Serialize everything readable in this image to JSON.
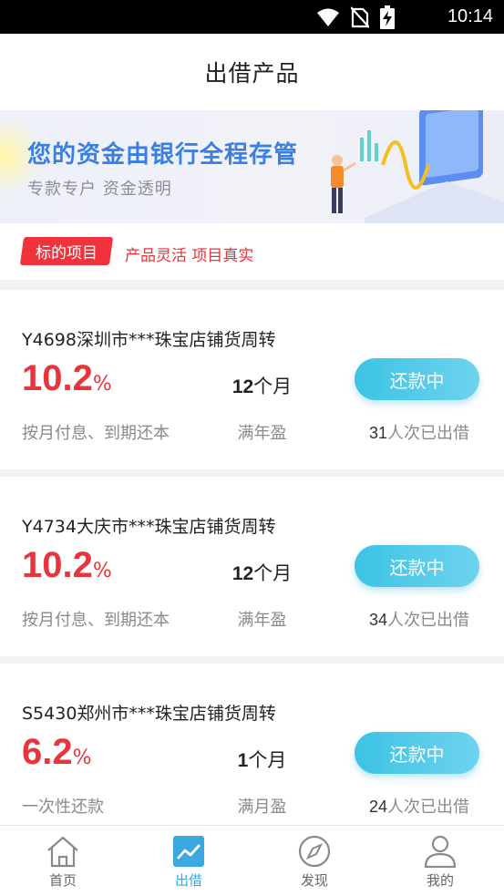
{
  "status_bar": {
    "time": "10:14",
    "icons": [
      "wifi-icon",
      "no-sim-icon",
      "battery-charging-icon"
    ]
  },
  "header": {
    "title": "出借产品"
  },
  "banner": {
    "headline": "您的资金由银行全程存管",
    "subline": "专款专户  资金透明"
  },
  "tag_row": {
    "tag": "标的项目",
    "slogan": "产品灵活 项目真实"
  },
  "products": [
    {
      "name": "Y4698深圳市***珠宝店铺货周转",
      "rate": "10.2",
      "rate_unit": "%",
      "term_num": "12",
      "term_unit": "个月",
      "button": "还款中",
      "repay_method": "按月付息、到期还本",
      "term_label": "满年盈",
      "count": "31",
      "count_suffix": "人次已出借"
    },
    {
      "name": "Y4734大庆市***珠宝店铺货周转",
      "rate": "10.2",
      "rate_unit": "%",
      "term_num": "12",
      "term_unit": "个月",
      "button": "还款中",
      "repay_method": "按月付息、到期还本",
      "term_label": "满年盈",
      "count": "34",
      "count_suffix": "人次已出借"
    },
    {
      "name": "S5430郑州市***珠宝店铺货周转",
      "rate": "6.2",
      "rate_unit": "%",
      "term_num": "1",
      "term_unit": "个月",
      "button": "还款中",
      "repay_method": "一次性还款",
      "term_label": "满月盈",
      "count": "24",
      "count_suffix": "人次已出借"
    }
  ],
  "tabbar": {
    "items": [
      {
        "label": "首页",
        "icon": "home-icon"
      },
      {
        "label": "出借",
        "icon": "trend-chart-icon",
        "active": true
      },
      {
        "label": "发现",
        "icon": "compass-icon"
      },
      {
        "label": "我的",
        "icon": "user-icon"
      }
    ]
  },
  "colors": {
    "accent_red": "#e8343c",
    "tag_red": "#f0323c",
    "button_blue": "#3cc3e4",
    "active_tab": "#3ba8e0",
    "banner_text": "#3b7fe0"
  }
}
